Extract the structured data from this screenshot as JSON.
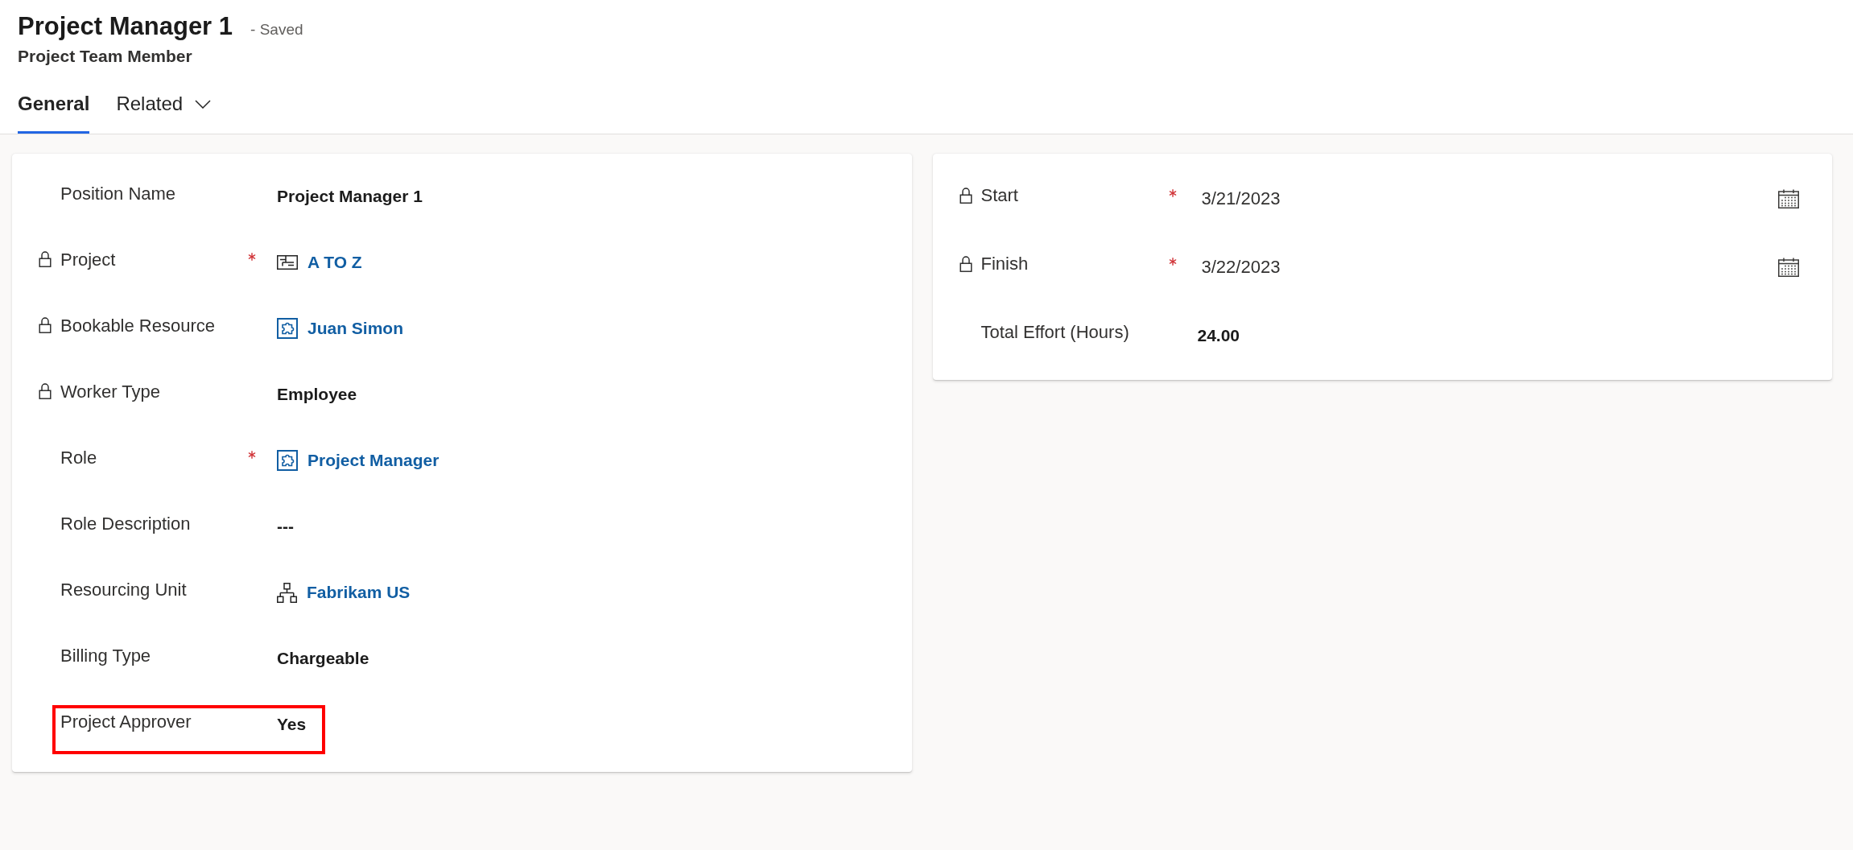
{
  "record": {
    "title": "Project Manager 1",
    "status": "- Saved",
    "entity": "Project Team Member"
  },
  "tabs": [
    {
      "label": "General",
      "selected": true,
      "dropdown": false
    },
    {
      "label": "Related",
      "selected": false,
      "dropdown": true
    }
  ],
  "sections": [
    {
      "fields": [
        {
          "label": "Position Name",
          "value": "Project Manager 1",
          "kind": "text",
          "locked": false,
          "required": false,
          "highlighted": false
        },
        {
          "label": "Project",
          "value": "A TO Z",
          "kind": "project",
          "locked": true,
          "required": true,
          "highlighted": false
        },
        {
          "label": "Bookable Resource",
          "value": "Juan Simon",
          "kind": "resource",
          "locked": true,
          "required": false,
          "highlighted": false
        },
        {
          "label": "Worker Type",
          "value": "Employee",
          "kind": "text",
          "locked": true,
          "required": false,
          "highlighted": false
        },
        {
          "label": "Role",
          "value": "Project Manager",
          "kind": "role",
          "locked": false,
          "required": true,
          "highlighted": false
        },
        {
          "label": "Role Description",
          "value": "---",
          "kind": "text",
          "locked": false,
          "required": false,
          "highlighted": false
        },
        {
          "label": "Resourcing Unit",
          "value": "Fabrikam US",
          "kind": "unit",
          "locked": false,
          "required": false,
          "highlighted": false
        },
        {
          "label": "Billing Type",
          "value": "Chargeable",
          "kind": "text",
          "locked": false,
          "required": false,
          "highlighted": false
        },
        {
          "label": "Project Approver",
          "value": "Yes",
          "kind": "text",
          "locked": false,
          "required": false,
          "highlighted": true
        }
      ]
    },
    {
      "fields": [
        {
          "label": "Start",
          "value": "3/21/2023",
          "kind": "date",
          "locked": true,
          "required": true,
          "highlighted": false
        },
        {
          "label": "Finish",
          "value": "3/22/2023",
          "kind": "date",
          "locked": true,
          "required": true,
          "highlighted": false
        },
        {
          "label": "Total Effort (Hours)",
          "value": "24.00",
          "kind": "text",
          "locked": false,
          "required": false,
          "highlighted": false
        }
      ]
    }
  ]
}
